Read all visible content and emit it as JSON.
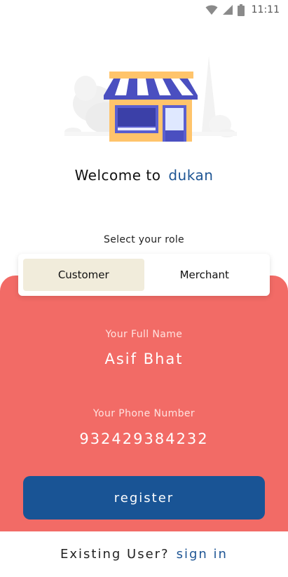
{
  "status_bar": {
    "time": "11:11",
    "icons": [
      "wifi-icon",
      "signal-icon",
      "battery-icon"
    ]
  },
  "welcome": {
    "prefix": "Welcome to",
    "brand": "dukan"
  },
  "role": {
    "label": "Select your role",
    "options": [
      "Customer",
      "Merchant"
    ],
    "selected": "Customer"
  },
  "form": {
    "name_label": "Your Full Name",
    "name_value": "Asif Bhat",
    "phone_label": "Your Phone Number",
    "phone_value": "932429384232"
  },
  "register": {
    "label": "register"
  },
  "footer": {
    "prompt": "Existing User?",
    "link": "sign in"
  },
  "colors": {
    "brand_blue": "#195495",
    "panel_red": "#f26b66",
    "selected_role_bg": "#f1ecdb"
  }
}
